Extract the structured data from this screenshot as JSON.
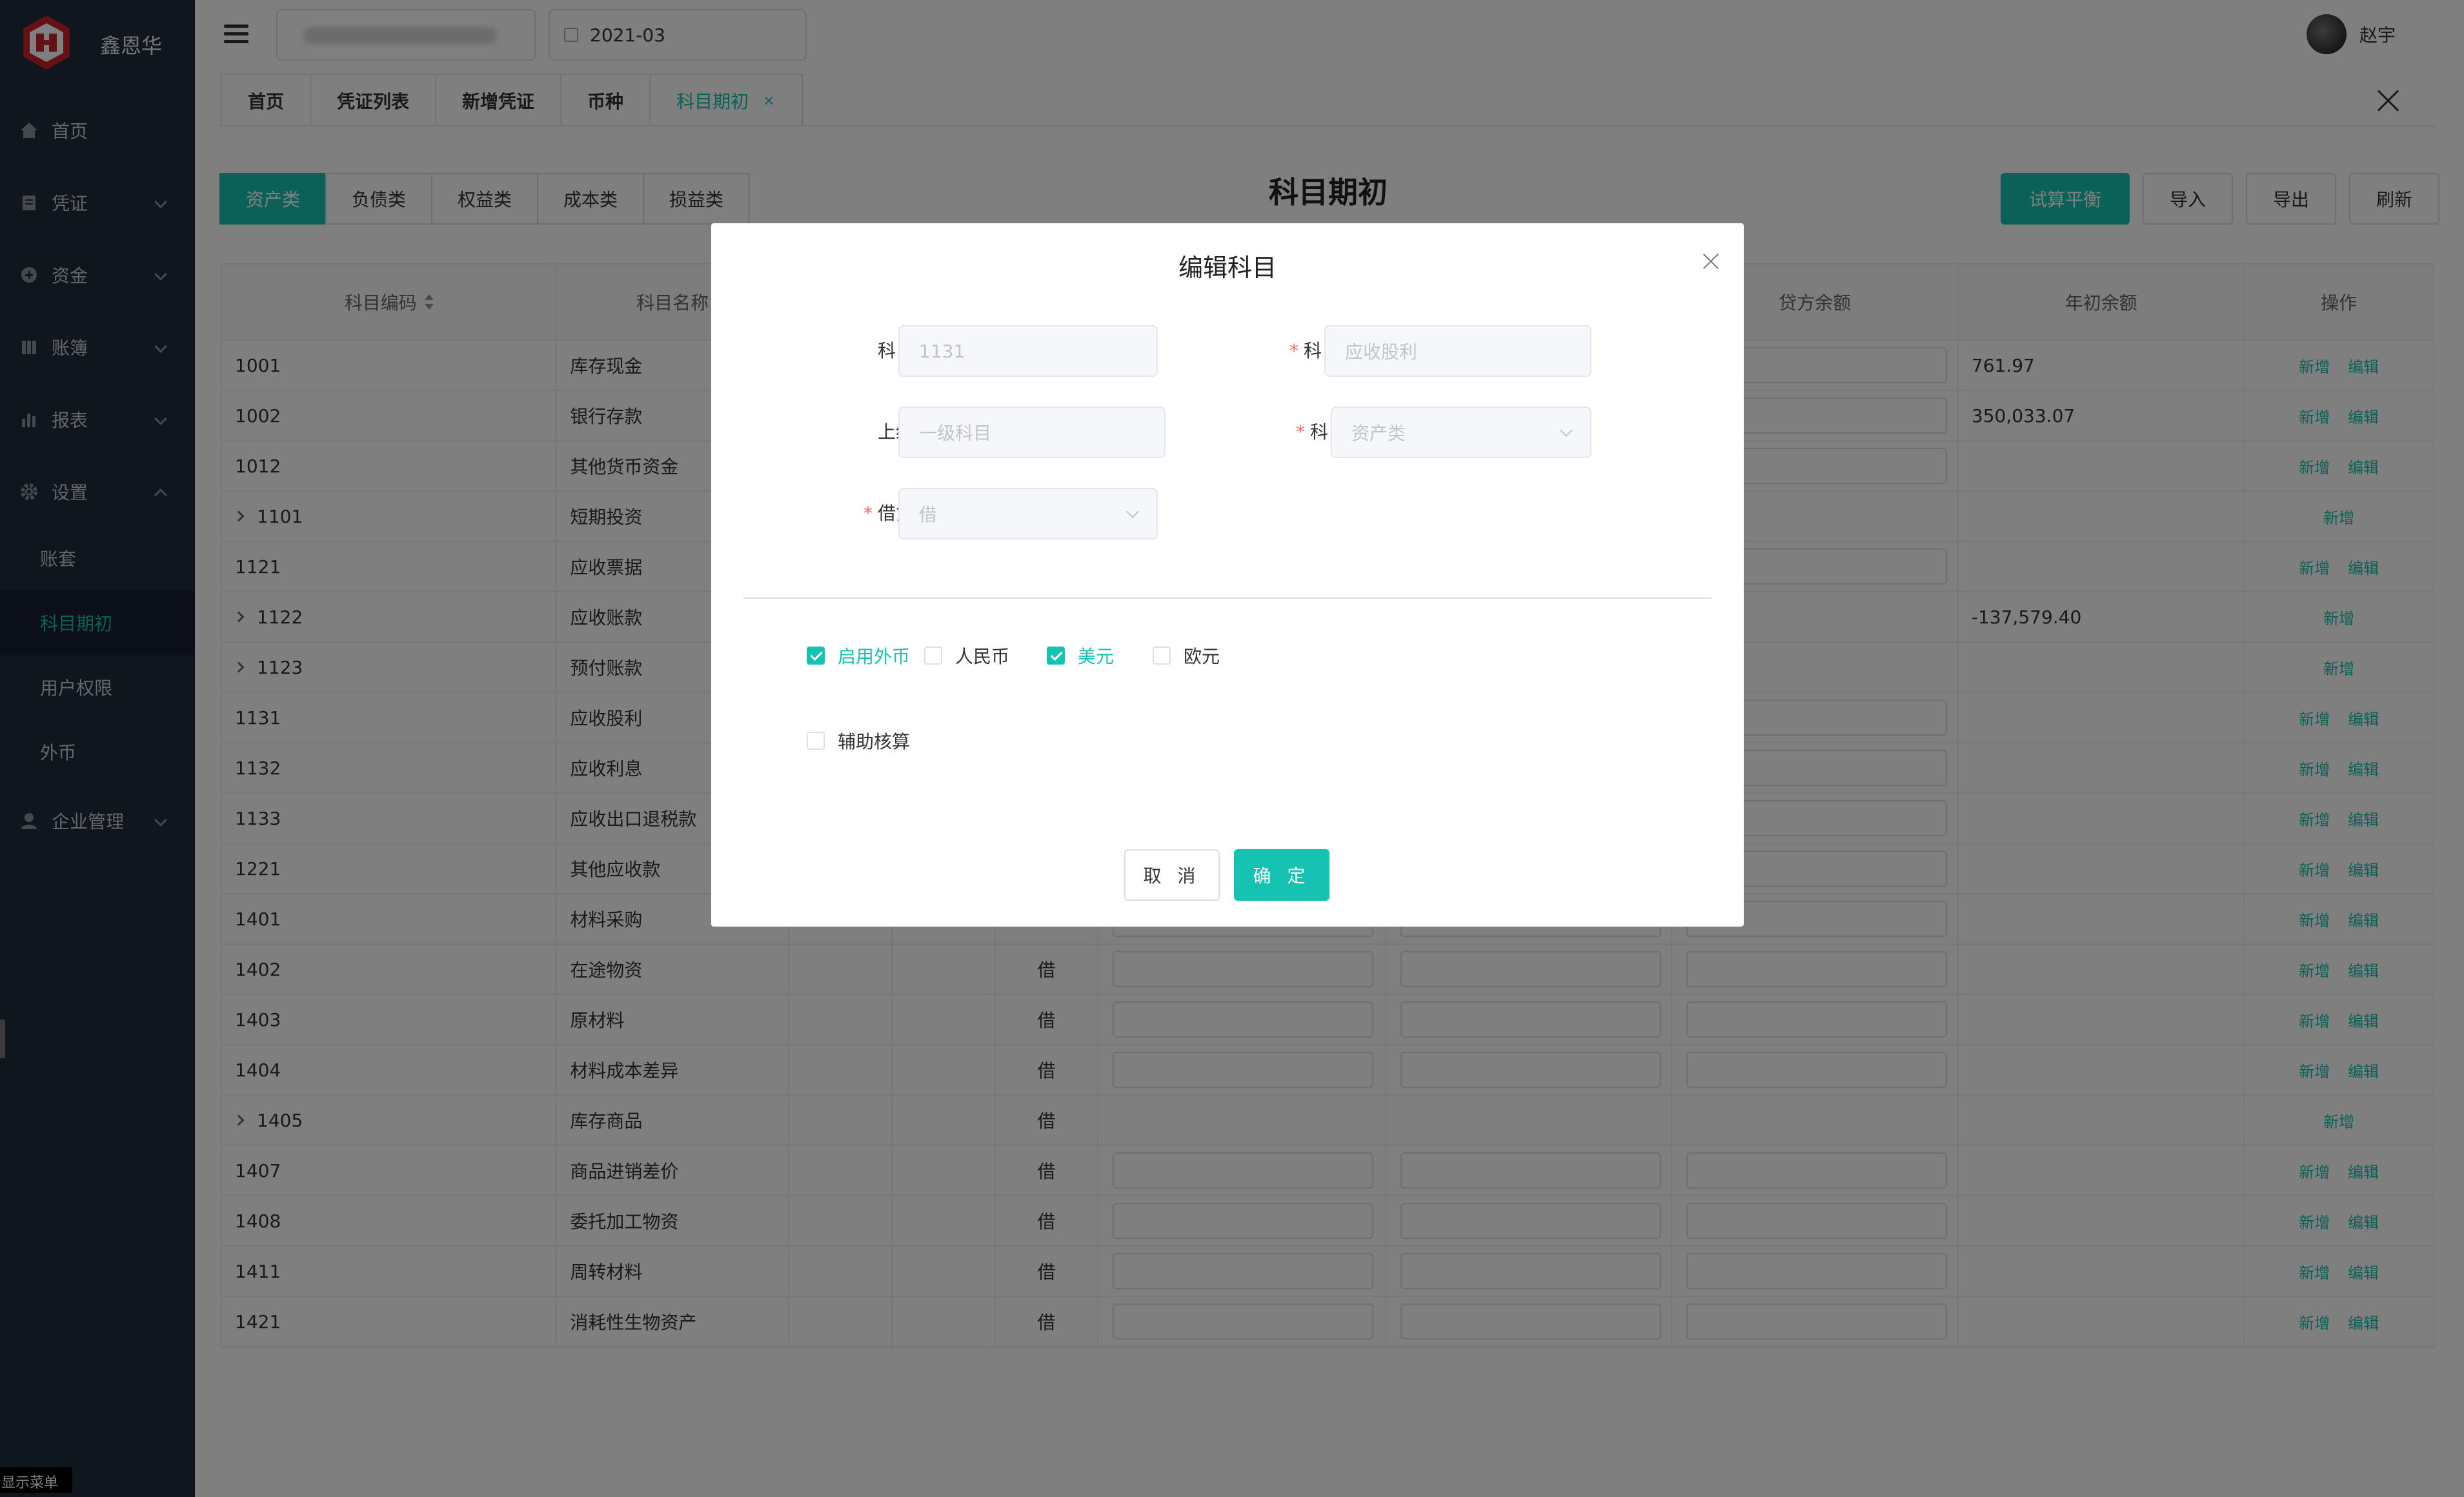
{
  "brand": {
    "name": "鑫恩华"
  },
  "sidebar": {
    "items": [
      {
        "label": "首页",
        "icon": "home-icon"
      },
      {
        "label": "凭证",
        "icon": "voucher-icon"
      },
      {
        "label": "资金",
        "icon": "funds-icon"
      },
      {
        "label": "账簿",
        "icon": "ledger-icon"
      },
      {
        "label": "报表",
        "icon": "report-icon"
      },
      {
        "label": "设置",
        "icon": "gear-icon"
      },
      {
        "label": "企业管理",
        "icon": "user-icon"
      }
    ],
    "sub_items": [
      {
        "label": "账套"
      },
      {
        "label": "科目期初"
      },
      {
        "label": "用户权限"
      },
      {
        "label": "外币"
      }
    ],
    "show_menu_label": "显示菜单"
  },
  "header": {
    "period": "2021-03",
    "user_name": "赵宇"
  },
  "tabs": [
    {
      "label": "首页"
    },
    {
      "label": "凭证列表"
    },
    {
      "label": "新增凭证"
    },
    {
      "label": "币种"
    },
    {
      "label": "科目期初",
      "close": "×"
    }
  ],
  "categories": [
    "资产类",
    "负债类",
    "权益类",
    "成本类",
    "损益类"
  ],
  "page": {
    "title": "科目期初",
    "buttons": {
      "trial_balance": "试算平衡",
      "import": "导入",
      "export": "导出",
      "refresh": "刷新"
    }
  },
  "table": {
    "headers": {
      "code": "科目编码",
      "name": "科目名称",
      "credit_balance": "贷方余额",
      "year_balance": "年初余额",
      "action": "操作"
    },
    "actions": {
      "add": "新增",
      "edit": "编辑"
    },
    "rows": [
      {
        "code": "1001",
        "name": "库存现金",
        "dir": "",
        "year": "761.97",
        "expand": false,
        "inputs": true,
        "editable": true
      },
      {
        "code": "1002",
        "name": "银行存款",
        "dir": "",
        "year": "350,033.07",
        "expand": false,
        "inputs": true,
        "editable": true
      },
      {
        "code": "1012",
        "name": "其他货币资金",
        "dir": "",
        "year": "",
        "expand": false,
        "inputs": true,
        "editable": true
      },
      {
        "code": "1101",
        "name": "短期投资",
        "dir": "",
        "year": "",
        "expand": true,
        "inputs": false,
        "editable": false
      },
      {
        "code": "1121",
        "name": "应收票据",
        "dir": "",
        "year": "",
        "expand": false,
        "inputs": true,
        "editable": true
      },
      {
        "code": "1122",
        "name": "应收账款",
        "dir": "",
        "year": "-137,579.40",
        "expand": true,
        "inputs": false,
        "editable": false
      },
      {
        "code": "1123",
        "name": "预付账款",
        "dir": "",
        "year": "",
        "expand": true,
        "inputs": false,
        "editable": false
      },
      {
        "code": "1131",
        "name": "应收股利",
        "dir": "",
        "year": "",
        "expand": false,
        "inputs": true,
        "editable": true
      },
      {
        "code": "1132",
        "name": "应收利息",
        "dir": "",
        "year": "",
        "expand": false,
        "inputs": true,
        "editable": true
      },
      {
        "code": "1133",
        "name": "应收出口退税款",
        "dir": "",
        "year": "",
        "expand": false,
        "inputs": true,
        "editable": true
      },
      {
        "code": "1221",
        "name": "其他应收款",
        "dir": "",
        "year": "",
        "expand": false,
        "inputs": true,
        "editable": true
      },
      {
        "code": "1401",
        "name": "材料采购",
        "dir": "",
        "year": "",
        "expand": false,
        "inputs": true,
        "editable": true
      },
      {
        "code": "1402",
        "name": "在途物资",
        "dir": "借",
        "year": "",
        "expand": false,
        "inputs": true,
        "editable": true
      },
      {
        "code": "1403",
        "name": "原材料",
        "dir": "借",
        "year": "",
        "expand": false,
        "inputs": true,
        "editable": true
      },
      {
        "code": "1404",
        "name": "材料成本差异",
        "dir": "借",
        "year": "",
        "expand": false,
        "inputs": true,
        "editable": true
      },
      {
        "code": "1405",
        "name": "库存商品",
        "dir": "借",
        "year": "",
        "expand": true,
        "inputs": false,
        "editable": false
      },
      {
        "code": "1407",
        "name": "商品进销差价",
        "dir": "借",
        "year": "",
        "expand": false,
        "inputs": true,
        "editable": true
      },
      {
        "code": "1408",
        "name": "委托加工物资",
        "dir": "借",
        "year": "",
        "expand": false,
        "inputs": true,
        "editable": true
      },
      {
        "code": "1411",
        "name": "周转材料",
        "dir": "借",
        "year": "",
        "expand": false,
        "inputs": true,
        "editable": true
      },
      {
        "code": "1421",
        "name": "消耗性生物资产",
        "dir": "借",
        "year": "",
        "expand": false,
        "inputs": true,
        "editable": true
      }
    ]
  },
  "dialog": {
    "title": "编辑科目",
    "fields": {
      "code_label": "科目编码",
      "code_value": "1131",
      "name_label": "科目名称",
      "name_value": "应收股利",
      "parent_label": "上级科目",
      "parent_value": "一级科目",
      "category_label": "科目类别",
      "category_value": "资产类",
      "direction_label": "借贷余额",
      "direction_value": "借",
      "required_mark": "*"
    },
    "checkboxes": [
      {
        "label": "启用外币",
        "checked": true
      },
      {
        "label": "人民币",
        "checked": false
      },
      {
        "label": "美元",
        "checked": true
      },
      {
        "label": "欧元",
        "checked": false
      },
      {
        "label": "辅助核算",
        "checked": false
      }
    ],
    "cancel_label": "取 消",
    "ok_label": "确 定"
  },
  "colors": {
    "accent": "#16c2b1",
    "sidebar_bg": "#1f2d3d",
    "required": "#f56c6c"
  }
}
